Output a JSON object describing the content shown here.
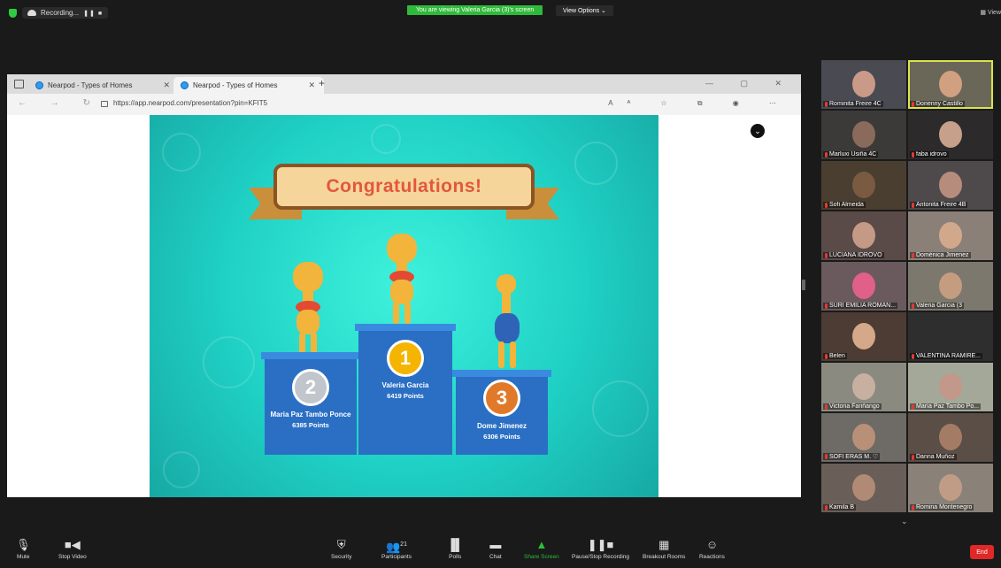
{
  "topbar": {
    "recording_label": "Recording...",
    "pause_stop": "❚❚ ■",
    "banner": "You are viewing Valeria Garcia (3)'s screen",
    "view_options": "View Options ⌄",
    "view_label": "▦ View"
  },
  "browser": {
    "tabs": [
      {
        "label": "Nearpod - Types of Homes",
        "close": "✕"
      },
      {
        "label": "Nearpod - Types of Homes",
        "close": "✕"
      }
    ],
    "new_tab": "+",
    "window_controls": "— ▢ ✕",
    "nav": "← → ↻",
    "url": "https://app.nearpod.com/presentation?pin=KFIT5",
    "tools": "Aᴬ ☆ ⧉ ◉ ⋯"
  },
  "slide": {
    "title": "Congratulations!",
    "podium": [
      {
        "rank": "2",
        "name": "Maria Paz Tambo Ponce",
        "points": "6385 Points"
      },
      {
        "rank": "1",
        "name": "Valeria Garcia",
        "points": "6419 Points"
      },
      {
        "rank": "3",
        "name": "Dome Jimenez",
        "points": "6306 Points"
      }
    ],
    "collapse_icon": "⌄"
  },
  "gallery": {
    "participants": [
      {
        "name": "Rominita Freire 4C"
      },
      {
        "name": "Dorienny Castillo"
      },
      {
        "name": "Marluxi Usiña 4C"
      },
      {
        "name": "faba idrovo"
      },
      {
        "name": "Sofi Almeida"
      },
      {
        "name": "Antonita Freire 4B"
      },
      {
        "name": "LUCIANA IDROVO"
      },
      {
        "name": "Doménica Jimenez"
      },
      {
        "name": "SURI EMILIA ROMAN..."
      },
      {
        "name": "Valeria Garcia (3"
      },
      {
        "name": "Belen"
      },
      {
        "name": "VALENTINA RAMIRE..."
      },
      {
        "name": "Victoria Fariñango"
      },
      {
        "name": "María Paz Tambo Po..."
      },
      {
        "name": "SOFI ERAS M. ♡"
      },
      {
        "name": "Danna Muñoz"
      },
      {
        "name": "Kamila B"
      },
      {
        "name": "Romina Montenegro"
      }
    ],
    "more": "⌄"
  },
  "toolbar": {
    "mute": "Mute",
    "stop_video": "Stop Video",
    "security": "Security",
    "participants": "Participants",
    "participants_count": "21",
    "polls": "Polls",
    "chat": "Chat",
    "share_screen": "Share Screen",
    "pause_stop_recording": "Pause/Stop Recording",
    "breakout_rooms": "Breakout Rooms",
    "reactions": "Reactions",
    "end": "End"
  },
  "colors": {
    "accent_green": "#2fba3a",
    "end_red": "#e02828",
    "podium_blue": "#2a6fc4",
    "slide_teal": "#1fd0c4"
  }
}
